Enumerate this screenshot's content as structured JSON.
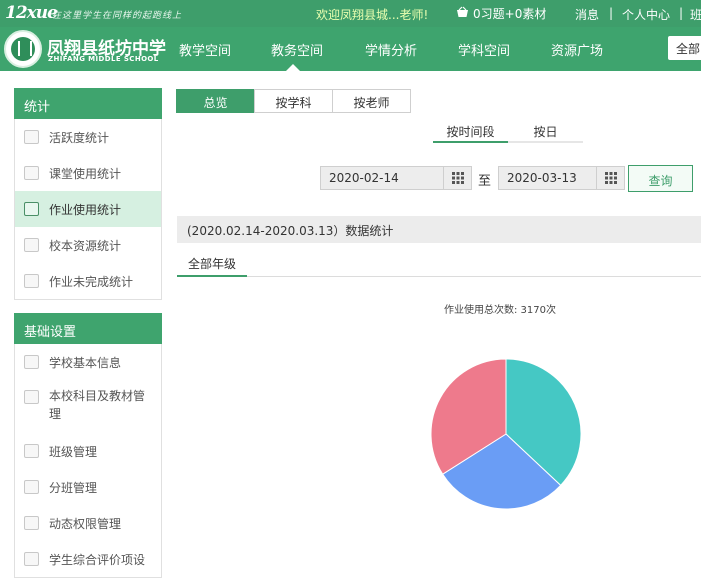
{
  "topbar": {
    "logo": "12xue",
    "slogan": "在这里学生在同样的起跑线上",
    "welcome": "欢迎凤翔县城...老师!",
    "cart": "0习题+0素材",
    "links": [
      "消息",
      "个人中心",
      "班"
    ]
  },
  "school": {
    "name": "凤翔县纸坊中学",
    "en": "ZHIFANG MIDDLE SCHOOL"
  },
  "nav": {
    "items": [
      "教学空间",
      "教务空间",
      "学情分析",
      "学科空间",
      "资源广场"
    ],
    "active": "教务空间",
    "select": "全部"
  },
  "sidebar": {
    "stats": {
      "title": "统计",
      "items": [
        "活跃度统计",
        "课堂使用统计",
        "作业使用统计",
        "校本资源统计",
        "作业未完成统计"
      ],
      "active": "作业使用统计"
    },
    "settings": {
      "title": "基础设置",
      "items": [
        "学校基本信息",
        "本校科目及教材管理",
        "班级管理",
        "分班管理",
        "动态权限管理",
        "学生综合评价项设"
      ]
    }
  },
  "main": {
    "tabs": [
      "总览",
      "按学科",
      "按老师"
    ],
    "active_tab": "总览",
    "subtabs": [
      "按时间段",
      "按日"
    ],
    "active_subtab": "按时间段",
    "date_from": "2020-02-14",
    "to_label": "至",
    "date_to": "2020-03-13",
    "query_label": "查询",
    "stat_title": "(2020.02.14-2020.03.13）数据统计",
    "grade_tab": "全部年级",
    "total_label": "作业使用总次数: 3170次"
  },
  "chart_data": {
    "type": "pie",
    "slices": [
      {
        "value": 0.37,
        "color": "#45c8c4"
      },
      {
        "value": 0.29,
        "color": "#6a9df5"
      },
      {
        "value": 0.34,
        "color": "#ee7a8c"
      }
    ]
  },
  "colors": {
    "brand": "#3ea46e",
    "active_bg": "#d6f0e1"
  }
}
